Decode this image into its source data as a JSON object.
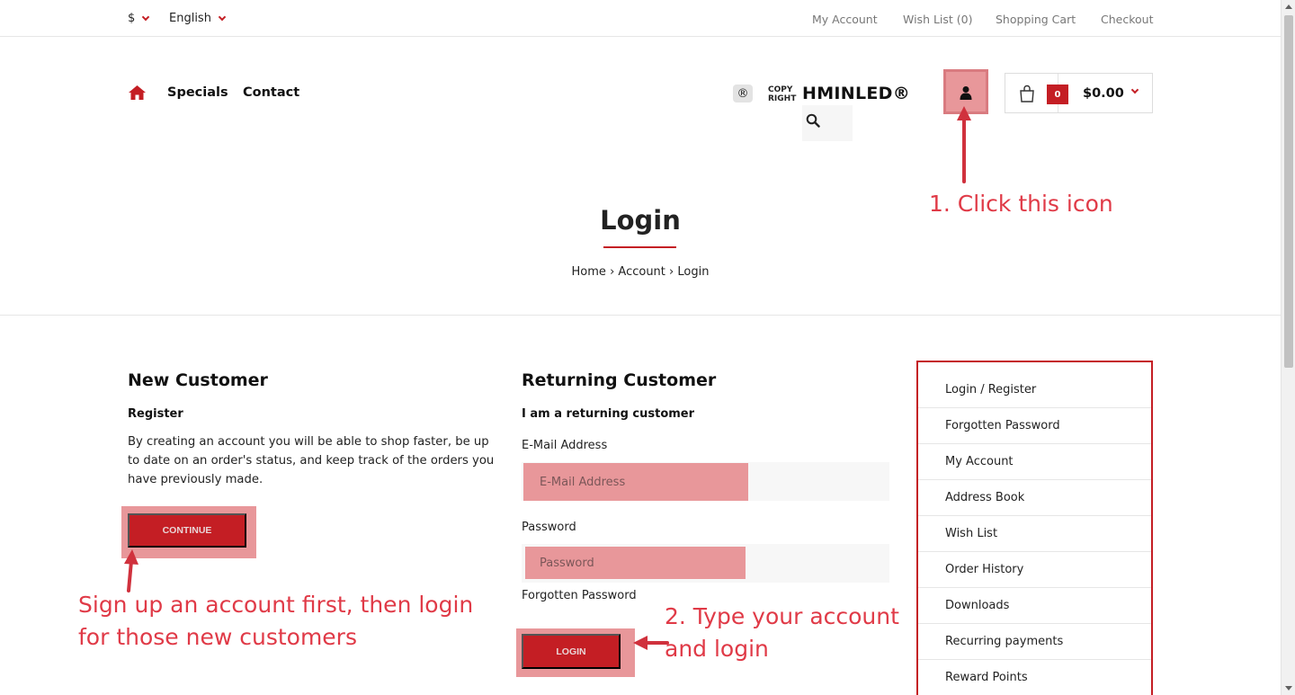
{
  "topbar": {
    "currency": "$",
    "language": "English",
    "links": [
      "My Account",
      "Wish List (0)",
      "Shopping Cart",
      "Checkout"
    ]
  },
  "nav": {
    "home_icon": "home-icon",
    "items": [
      "Specials",
      "Contact"
    ]
  },
  "brand": {
    "registered_symbol": "®",
    "copyright_line1": "COPY",
    "copyright_line2": "RIGHT",
    "logo": "HMINLED®"
  },
  "cart": {
    "count": "0",
    "total": "$0.00"
  },
  "page": {
    "title": "Login",
    "breadcrumb": [
      "Home",
      "Account",
      "Login"
    ],
    "breadcrumb_sep": "›"
  },
  "new_customer": {
    "heading": "New Customer",
    "subheading": "Register",
    "text": "By creating an account you will be able to shop faster, be up to date on an order's status, and keep track of the orders you have previously made.",
    "button": "CONTINUE"
  },
  "returning_customer": {
    "heading": "Returning Customer",
    "subheading": "I am a returning customer",
    "email_label": "E-Mail Address",
    "email_placeholder": "E-Mail Address",
    "password_label": "Password",
    "password_placeholder": "Password",
    "forgotten": "Forgotten Password",
    "button": "LOGIN"
  },
  "sidebar": {
    "items": [
      "Login / Register",
      "Forgotten Password",
      "My Account",
      "Address Book",
      "Wish List",
      "Order History",
      "Downloads",
      "Recurring payments",
      "Reward Points"
    ]
  },
  "annotations": {
    "step1": "1. Click this icon",
    "step2_line1": "2. Type your account",
    "step2_line2": "and login",
    "signup_line1": "Sign up an account first, then login",
    "signup_line2": "for those new customers"
  },
  "colors": {
    "accent": "#c41e24",
    "highlight": "#e8979a",
    "annotation": "#e03a47"
  }
}
